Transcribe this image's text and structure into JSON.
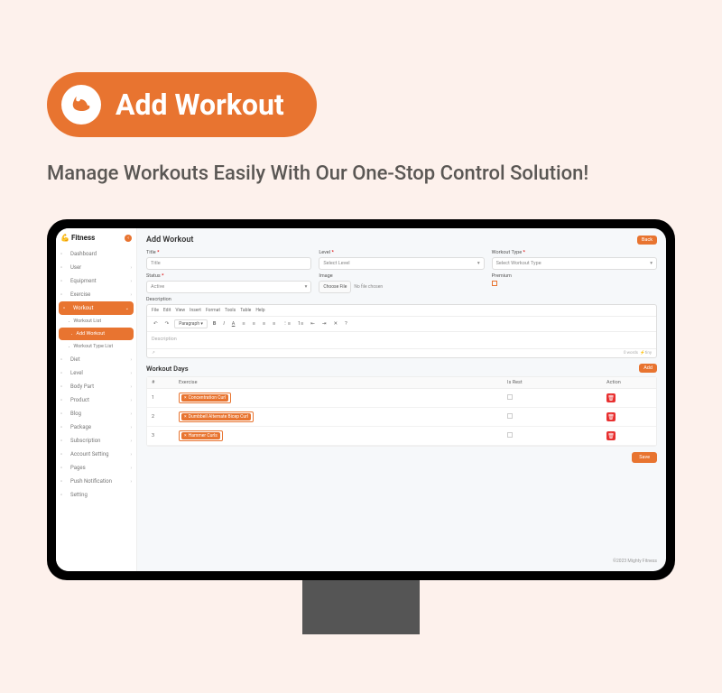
{
  "hero": {
    "title": "Add Workout"
  },
  "tagline": "Manage Workouts Easily With Our One-Stop Control Solution!",
  "app": {
    "name": "Fitness"
  },
  "sidebar": {
    "items": [
      {
        "label": "Dashboard",
        "icon": "dashboard",
        "expand": false
      },
      {
        "label": "User",
        "icon": "user",
        "expand": true
      },
      {
        "label": "Equipment",
        "icon": "equipment",
        "expand": true
      },
      {
        "label": "Exercise",
        "icon": "exercise",
        "expand": true
      },
      {
        "label": "Workout",
        "icon": "workout",
        "expand": true,
        "active": true
      },
      {
        "label": "Workout List",
        "sub": true
      },
      {
        "label": "Add Workout",
        "sub": true,
        "active": true
      },
      {
        "label": "Workout Type List",
        "sub": true
      },
      {
        "label": "Diet",
        "icon": "diet",
        "expand": true
      },
      {
        "label": "Level",
        "icon": "level",
        "expand": true
      },
      {
        "label": "Body Part",
        "icon": "bodypart",
        "expand": true
      },
      {
        "label": "Product",
        "icon": "product",
        "expand": true
      },
      {
        "label": "Blog",
        "icon": "blog",
        "expand": true
      },
      {
        "label": "Package",
        "icon": "package",
        "expand": true
      },
      {
        "label": "Subscription",
        "icon": "subscription",
        "expand": true
      },
      {
        "label": "Account Setting",
        "icon": "account",
        "expand": true
      },
      {
        "label": "Pages",
        "icon": "pages",
        "expand": true
      },
      {
        "label": "Push Notification",
        "icon": "push",
        "expand": true
      },
      {
        "label": "Setting",
        "icon": "setting",
        "expand": false
      }
    ]
  },
  "page": {
    "title": "Add Workout",
    "back": "Back",
    "form": {
      "title": {
        "label": "Title",
        "placeholder": "Title"
      },
      "level": {
        "label": "Level",
        "placeholder": "Select Level"
      },
      "workout_type": {
        "label": "Workout Type",
        "placeholder": "Select Workout Type"
      },
      "status": {
        "label": "Status",
        "value": "Active"
      },
      "image": {
        "label": "Image",
        "button": "Choose File",
        "no_file": "No file chosen"
      },
      "premium": {
        "label": "Premium"
      },
      "description": {
        "label": "Description",
        "placeholder": "Description"
      }
    },
    "editor": {
      "menu": [
        "File",
        "Edit",
        "View",
        "Insert",
        "Format",
        "Tools",
        "Table",
        "Help"
      ],
      "para": "Paragraph",
      "words": "0 words",
      "tiny": "tiny"
    },
    "days": {
      "title": "Workout Days",
      "add": "Add",
      "headers": {
        "n": "#",
        "ex": "Exercise",
        "rest": "Is Rest",
        "act": "Action"
      },
      "rows": [
        {
          "n": "1",
          "tags": [
            "Concentration Curl"
          ]
        },
        {
          "n": "2",
          "tags": [
            "Dumbbell Alternate Bicep Curl"
          ]
        },
        {
          "n": "3",
          "tags": [
            "Hammer Curls"
          ]
        }
      ]
    },
    "save": "Save",
    "footer": "©2023 Mighty Fitness"
  }
}
